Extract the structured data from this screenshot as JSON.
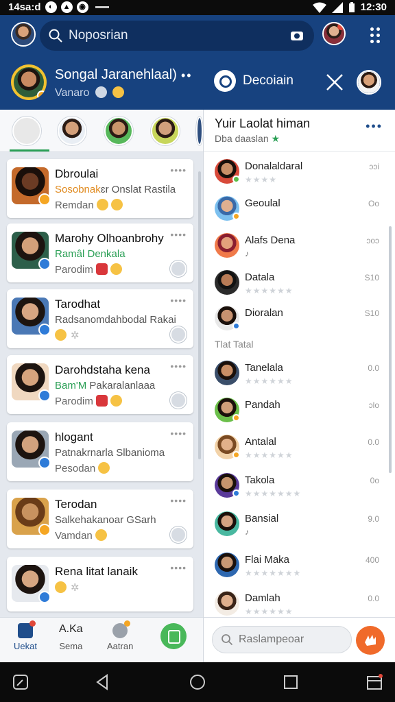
{
  "status": {
    "left_text": "14sa:d",
    "time": "12:30"
  },
  "appbar": {
    "search_placeholder": "Noposrian",
    "me_title": "Songal Jaranehlaal)",
    "me_subtitle": "Vanaro",
    "more_dots": "••",
    "discover_label": "Decoiain",
    "search_icon": "search-icon",
    "camera_icon": "camera-icon"
  },
  "cards": [
    {
      "name": "Dbroulai",
      "line2_accent": "Sosobnak",
      "line2": "ɛr Onslat Rastila",
      "line3": "Remdan",
      "more": "••••",
      "emojis": [
        "yellow",
        "yellow"
      ]
    },
    {
      "name": "Marohy Olhoanbrohy",
      "line2_accent": "Ramâl Denkala",
      "line2": "",
      "line3": "Parodim",
      "more": "••••",
      "emojis": [
        "red",
        "yellow"
      ]
    },
    {
      "name": "Tarodhat",
      "line2_accent": "",
      "line2": "Radsanomdahbodal Rakai",
      "line3": "",
      "more": "••••",
      "emojis": [
        "yellow"
      ]
    },
    {
      "name": "Darohdstaha kena",
      "line2_accent": "Bam'M",
      "line2": "Pakaralanlaaa",
      "line3": "Parodim",
      "more": "••••",
      "emojis": [
        "red",
        "yellow"
      ]
    },
    {
      "name": "hlogant",
      "line2_accent": "",
      "line2": "Patnakrnarla Slbanioma",
      "line3": "Pesodan",
      "more": "••••",
      "emojis": [
        "yellow"
      ]
    },
    {
      "name": "Terodan",
      "line2_accent": "",
      "line2": "Salkehakanoar GSarh",
      "line3": "Vamdan",
      "more": "••••",
      "emojis": [
        "yellow"
      ]
    },
    {
      "name": "Rena litat lanaik",
      "line2_accent": "",
      "line2": "",
      "line3": "",
      "more": "••••",
      "emojis": [
        "yellow"
      ]
    }
  ],
  "right": {
    "title": "Yuir Laolat himan",
    "subtitle": "Dba daaslan",
    "more": "•••",
    "section_label": "Tlat Tatal",
    "rows": [
      {
        "name": "Donalaldaral",
        "value": "ɔɔi"
      },
      {
        "name": "Geoulal",
        "value": "Oo"
      },
      {
        "name": "Alafs Dena",
        "value": "ɔoɔ"
      },
      {
        "name": "Datala",
        "value": "S10"
      },
      {
        "name": "Dioralan",
        "value": "S10"
      },
      {
        "name": "Tanelala",
        "value": "0.0"
      },
      {
        "name": "Pandah",
        "value": "ɔlo"
      },
      {
        "name": "Antalal",
        "value": "0.0"
      },
      {
        "name": "Takola",
        "value": "0o"
      },
      {
        "name": "Bansial",
        "value": "9.0"
      },
      {
        "name": "Flai Maka",
        "value": "400"
      },
      {
        "name": "Damlah",
        "value": "0.0"
      }
    ]
  },
  "tabs": [
    {
      "label": "Uekat",
      "icon": "home-icon"
    },
    {
      "label": "Sema",
      "top": "A.Ka",
      "icon": "text-icon"
    },
    {
      "label": "Aatran",
      "icon": "activity-icon"
    }
  ],
  "bottom_search_placeholder": "Raslampeoar",
  "colors": {
    "appbar": "#17427f",
    "accent_green": "#2a9f55",
    "send": "#f06a2a"
  }
}
